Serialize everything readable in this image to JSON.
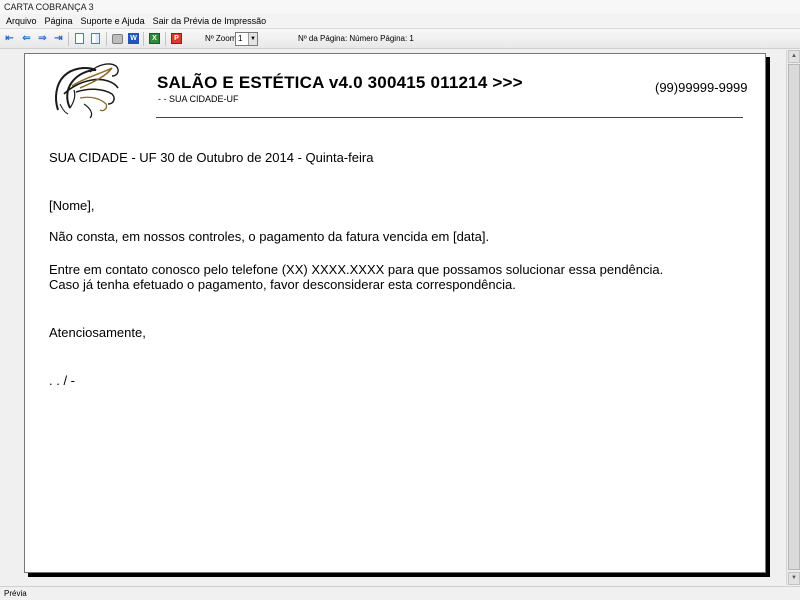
{
  "window": {
    "title": "CARTA COBRANÇA 3"
  },
  "menu": [
    "Arquivo",
    "Página",
    "Suporte e Ajuda",
    "Sair da Prévia de Impressão"
  ],
  "toolbar": {
    "icons": [
      "first-page-icon",
      "previous-page-icon",
      "next-page-icon",
      "last-page-icon",
      "single-page-icon",
      "two-pages-icon",
      "print-icon",
      "page-width-icon",
      "export-excel-icon",
      "export-pdf-icon"
    ],
    "zoom_label": "Nº Zoom",
    "zoom_value": "1",
    "page_info": "Nº da Página: Número Página: 1"
  },
  "document": {
    "company_title": "SALÃO E ESTÉTICA v4.0 300415 011214 >>>",
    "address_line": "-  - SUA CIDADE-UF",
    "phone": "(99)99999-9999",
    "date_line": "SUA CIDADE - UF 30 de Outubro de 2014 - Quinta-feira",
    "greeting": "[Nome],",
    "paragraph1": "Não consta, em nossos controles, o pagamento da fatura vencida em [data].",
    "paragraph2_line1": "Entre em contato conosco pelo telefone (XX) XXXX.XXXX para que possamos solucionar essa pendência.",
    "paragraph2_line2": "Caso já tenha efetuado o pagamento, favor desconsiderar esta correspondência.",
    "closing": "Atenciosamente,",
    "signature": ".   .   /    -"
  },
  "statusbar": {
    "text": "Prévia"
  },
  "colors": {
    "nav_icon": "#2a6fc9",
    "page_background": "#ffffff",
    "window_background": "#f0f0f0"
  }
}
